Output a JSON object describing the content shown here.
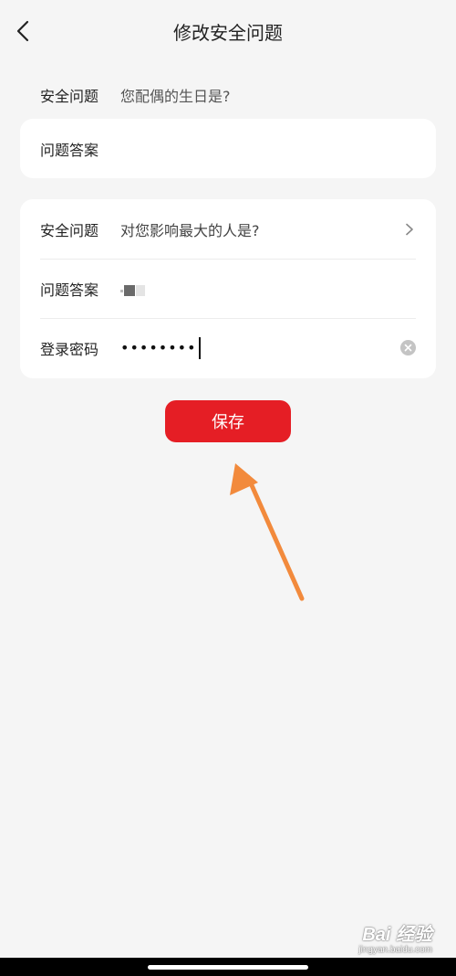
{
  "header": {
    "title": "修改安全问题"
  },
  "current": {
    "question_label": "安全问题",
    "question_value": "您配偶的生日是?",
    "answer_label": "问题答案",
    "answer_value": ""
  },
  "new": {
    "question_label": "安全问题",
    "question_value": "对您影响最大的人是?",
    "answer_label": "问题答案",
    "password_label": "登录密码",
    "password_value": "••••••••"
  },
  "actions": {
    "save_label": "保存"
  },
  "watermark": {
    "brand": "Bai 经验",
    "url": "jingyan.baidu.com"
  },
  "colors": {
    "primary": "#e51e25",
    "annotation_arrow": "#f28a3c",
    "background": "#f5f5f5"
  }
}
